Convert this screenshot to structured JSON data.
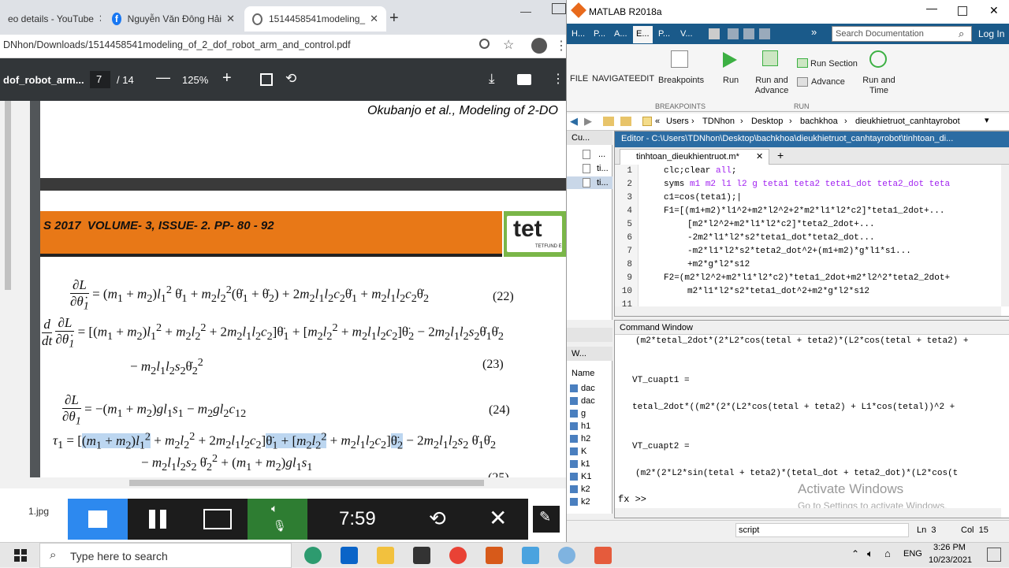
{
  "chrome": {
    "tabs": [
      {
        "label": "eo details - YouTube"
      },
      {
        "label": "Nguyễn Văn Đông Hải"
      },
      {
        "label": "1514458541modeling_"
      }
    ],
    "url": "DNhon/Downloads/1514458541modeling_of_2_dof_robot_arm_and_control.pdf"
  },
  "pdf": {
    "title": "dof_robot_arm...",
    "page": "7",
    "total": "/ 14",
    "zoom": "125%",
    "header_author": "Okubanjo et al., Modeling of 2-DO",
    "banner": "S 2017  VOLUME- 3, ISSUE- 2. PP- 80 - 92",
    "logo_text": "tet",
    "logo_sub": "TETFUND E",
    "eq_numbers": [
      "(22)",
      "(23)",
      "(24)",
      "(25)"
    ]
  },
  "matlab": {
    "title": "MATLAB R2018a",
    "tabs": [
      "H...",
      "P...",
      "A...",
      "E...",
      "P...",
      "V..."
    ],
    "search_placeholder": "Search Documentation",
    "login": "Log In",
    "ribbon": {
      "file": "FILE",
      "navigate": "NAVIGATE",
      "edit": "EDIT",
      "breakpoints": "Breakpoints",
      "breakpoints_group": "BREAKPOINTS",
      "run": "Run",
      "run_advance": "Run and Advance",
      "run_section": "Run Section",
      "advance": "Advance",
      "run_time": "Run and Time",
      "run_group": "RUN"
    },
    "path": [
      "Users",
      "TDNhon",
      "Desktop",
      "bachkhoa",
      "dieukhietruot_canhtayrobot"
    ],
    "current_folder": {
      "title": "Cu...",
      "items": [
        "...",
        "ti...",
        "ti..."
      ]
    },
    "editor": {
      "header": "Editor - C:\\Users\\TDNhon\\Desktop\\bachkhoa\\dieukhietruot_canhtayrobot\\tinhtoan_di...",
      "tab": "tinhtoan_dieukhientruot.m*",
      "line_numbers": [
        "1",
        "2",
        "3",
        "4",
        "5",
        "6",
        "7",
        "8",
        "9",
        "10",
        "11"
      ]
    },
    "workspace": {
      "title": "W...",
      "header": "Name",
      "vars": [
        "dac",
        "dac",
        "g",
        "h1",
        "h2",
        "K",
        "k1",
        "K1",
        "k2",
        "k2"
      ]
    },
    "cmd": {
      "title": "Command Window",
      "lines": [
        "(m2*tetal_2dot*(2*L2*cos(tetal + teta2)*(L2*cos(tetal + teta2) +",
        "VT_cuapt1 =",
        "tetal_2dot*((m2*(2*(L2*cos(tetal + teta2) + L1*cos(tetal))^2 +",
        "VT_cuapt2 =",
        "(m2*(2*L2*sin(tetal + teta2)*(tetal_dot + teta2_dot)*(L2*cos(t"
      ],
      "prompt": "fx >>"
    },
    "status": {
      "script": "script",
      "ln": "Ln  3",
      "col": "Col  15"
    },
    "watermark1": "Activate Windows",
    "watermark2": "Go to Settings to activate Windows."
  },
  "video": {
    "file": "1.jpg",
    "time": "7:59"
  },
  "taskbar": {
    "search_placeholder": "Type here to search",
    "time": "3:26 PM",
    "date": "10/23/2021",
    "lang": "ENG"
  }
}
